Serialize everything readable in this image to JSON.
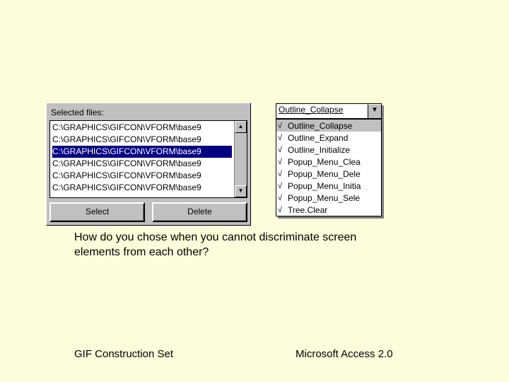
{
  "left_panel": {
    "label": "Selected files:",
    "items": [
      "C:\\GRAPHICS\\GIFCON\\VFORM\\base9",
      "C:\\GRAPHICS\\GIFCON\\VFORM\\base9",
      "C:\\GRAPHICS\\GIFCON\\VFORM\\base9",
      "C:\\GRAPHICS\\GIFCON\\VFORM\\base9",
      "C:\\GRAPHICS\\GIFCON\\VFORM\\base9",
      "C:\\GRAPHICS\\GIFCON\\VFORM\\base9"
    ],
    "selected_index": 2,
    "select_btn": "Select",
    "delete_btn": "Delete"
  },
  "right_combo": {
    "value": "Outline_Collapse",
    "options": [
      "Outline_Collapse",
      "Outline_Expand",
      "Outline_Initialize",
      "Popup_Menu_Clea",
      "Popup_Menu_Dele",
      "Popup_Menu_Initia",
      "Popup_Menu_Sele",
      "Tree.Clear"
    ],
    "selected_index": 0
  },
  "caption": "How do you chose when you cannot discriminate screen elements from each other?",
  "footer_left": "GIF Construction Set",
  "footer_right": "Microsoft Access 2.0",
  "glyphs": {
    "up": "▲",
    "down": "▼",
    "dropdown": "▼",
    "check": "√"
  }
}
